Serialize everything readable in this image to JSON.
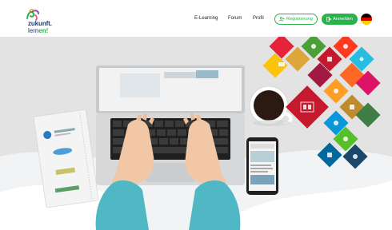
{
  "logo": {
    "line1": "zukunft.",
    "line2_prefix": "lern",
    "line2_accent": "en!"
  },
  "nav": [
    {
      "label": "E-Learning"
    },
    {
      "label": "Forum"
    },
    {
      "label": "Profil"
    }
  ],
  "actions": {
    "register": {
      "label": "Registrierung",
      "icon": "user-plus-icon"
    },
    "login": {
      "label": "Anmelden",
      "icon": "login-arrow-icon"
    }
  },
  "language": {
    "flag": "de",
    "colors": [
      "#000000",
      "#dd0000",
      "#ffce00"
    ]
  },
  "colors": {
    "brand_green": "#2ab24b",
    "brand_navy": "#1f3b6e"
  }
}
